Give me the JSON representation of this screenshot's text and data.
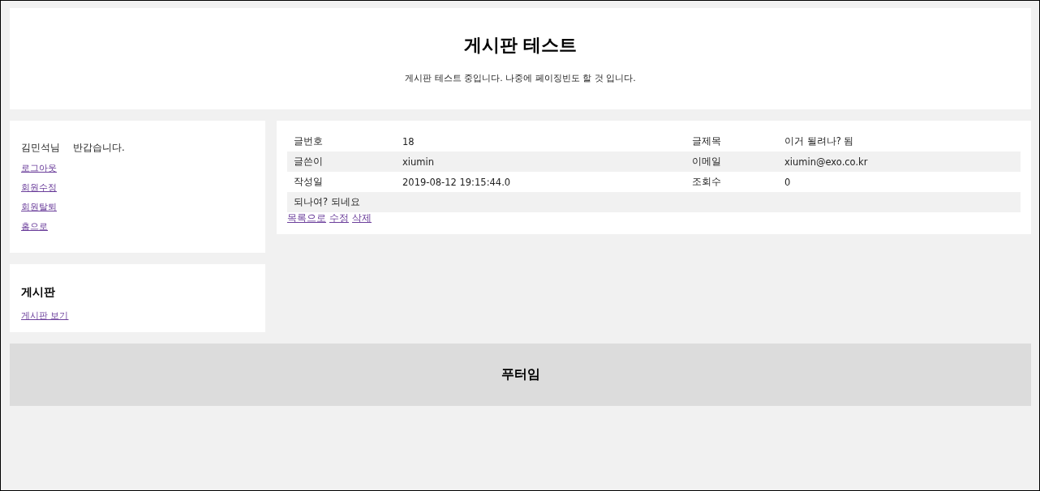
{
  "header": {
    "title": "게시판 테스트",
    "subtitle": "게시판 테스트 중입니다. 나중에 페이징빈도 할 것 입니다."
  },
  "user_panel": {
    "user": "김민석님",
    "greeting": "반갑습니다.",
    "links": [
      "로그아웃",
      "회원수정",
      "회원탈퇴",
      "홈으로"
    ]
  },
  "board_panel": {
    "heading": "게시판",
    "links": [
      "게시판 보기"
    ]
  },
  "post": {
    "rows": [
      {
        "cells": [
          "글번호",
          "18",
          "글제목",
          "이거 될려나? 됨"
        ]
      },
      {
        "cells": [
          "글쓴이",
          "xiumin",
          "이메일",
          "xiumin@exo.co.kr"
        ]
      },
      {
        "cells": [
          "작성일",
          "2019-08-12 19:15:44.0",
          "조회수",
          "0"
        ]
      }
    ],
    "content": "되나여? 되네요",
    "actions": [
      "목록으로",
      "수정",
      "삭제"
    ]
  },
  "footer": {
    "title": "푸터임"
  }
}
